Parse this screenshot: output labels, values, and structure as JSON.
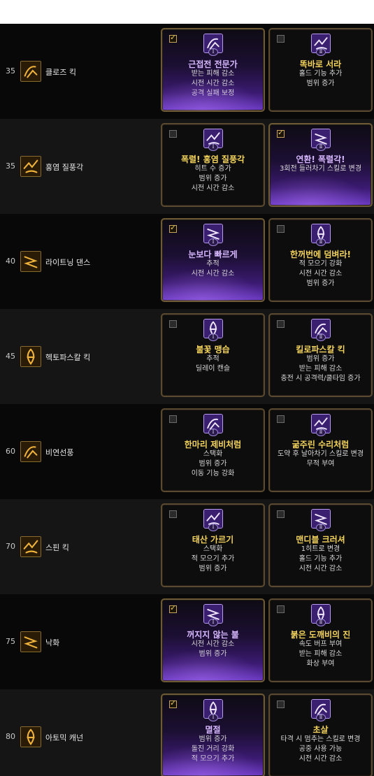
{
  "roman": [
    "Ⅰ",
    "Ⅱ"
  ],
  "skills": [
    {
      "level": "35",
      "name": "클로즈 킥",
      "icon": "kick-icon",
      "options": [
        {
          "selected": true,
          "title": "근접전 전문가",
          "lines": [
            "받는 피해 감소",
            "시전 시간 감소",
            "공격 실패 보정"
          ]
        },
        {
          "selected": false,
          "title": "똑바로 서라",
          "lines": [
            "홀드 기능 추가",
            "범위 증가"
          ]
        }
      ]
    },
    {
      "level": "35",
      "name": "홍염 질풍각",
      "icon": "flame-kick-icon",
      "options": [
        {
          "selected": false,
          "title": "폭렬! 홍염 질풍각",
          "lines": [
            "히트 수 증가",
            "범위 증가",
            "시전 시간 감소"
          ]
        },
        {
          "selected": true,
          "title": "연환! 폭렬각!",
          "lines": [
            "3회전 들러차기 스킬로 변경"
          ]
        }
      ]
    },
    {
      "level": "40",
      "name": "라이트닝 댄스",
      "icon": "lightning-icon",
      "options": [
        {
          "selected": true,
          "title": "눈보다 빠르게",
          "lines": [
            "추적",
            "시전 시간 감소"
          ]
        },
        {
          "selected": false,
          "title": "한꺼번에 덤벼라!",
          "lines": [
            "적 모으기 강화",
            "시전 시간 감소",
            "범위 증가"
          ]
        }
      ]
    },
    {
      "level": "45",
      "name": "헥토파스칼 킥",
      "icon": "tornado-kick-icon",
      "options": [
        {
          "selected": false,
          "title": "불꽃 맹습",
          "lines": [
            "추적",
            "딜레이 캔슬"
          ]
        },
        {
          "selected": false,
          "title": "킬로파스칼 킥",
          "lines": [
            "범위 증가",
            "받는 피해 감소",
            "충전 시 공격력/쿨타임 증가"
          ]
        }
      ]
    },
    {
      "level": "60",
      "name": "비연선풍",
      "icon": "swirl-icon",
      "options": [
        {
          "selected": false,
          "title": "한마리 제비처럼",
          "lines": [
            "스택화",
            "범위 증가",
            "이동 기능 강화"
          ]
        },
        {
          "selected": false,
          "title": "굶주린 수리처럼",
          "lines": [
            "도약 후 날아차기 스킬로 변경",
            "무적 부여"
          ]
        }
      ]
    },
    {
      "level": "70",
      "name": "스핀 킥",
      "icon": "spin-kick-icon",
      "options": [
        {
          "selected": false,
          "title": "태산 가르기",
          "lines": [
            "스택화",
            "적 모으기 추가",
            "범위 증가"
          ]
        },
        {
          "selected": false,
          "title": "맨디블 크러셔",
          "lines": [
            "1히트로 변경",
            "홀드 기능 추가",
            "시전 시간 감소"
          ]
        }
      ]
    },
    {
      "level": "75",
      "name": "낙화",
      "icon": "falling-flower-icon",
      "options": [
        {
          "selected": true,
          "title": "꺼지지 않는 불",
          "lines": [
            "시전 시간 감소",
            "범위 증가"
          ]
        },
        {
          "selected": false,
          "title": "붉은 도깨비의 진",
          "lines": [
            "속도 버프 부여",
            "받는 피해 감소",
            "화상 부여"
          ]
        }
      ]
    },
    {
      "level": "80",
      "name": "아토믹 캐넌",
      "icon": "atomic-cannon-icon",
      "options": [
        {
          "selected": true,
          "title": "멸절",
          "lines": [
            "범위 증가",
            "돌진 거리 강화",
            "적 모으기 추가"
          ]
        },
        {
          "selected": false,
          "title": "초살",
          "lines": [
            "타격 시 멈추는 스킬로 변경",
            "공중 사용 가능",
            "시전 시간 감소"
          ]
        }
      ]
    }
  ],
  "colors": {
    "title_gold": "#f3d35c",
    "title_selected": "#d7b8ff",
    "card_border": "#5b4a2f",
    "selected_glow": "#6c3ac4"
  }
}
